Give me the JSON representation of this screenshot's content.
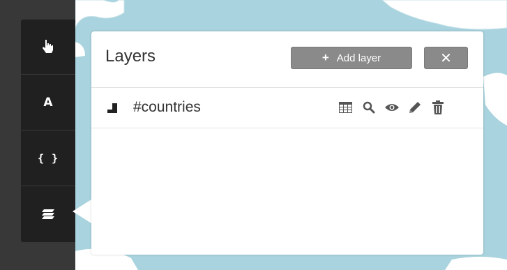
{
  "toolbar": {
    "tools": [
      {
        "name": "pointer-tool",
        "icon": "hand-pointer-icon",
        "label": ""
      },
      {
        "name": "text-tool",
        "icon": "text-icon",
        "label": "A"
      },
      {
        "name": "code-tool",
        "icon": "braces-icon",
        "label": "{ }"
      },
      {
        "name": "layers-tool",
        "icon": "layers-icon",
        "label": ""
      }
    ]
  },
  "panel": {
    "title": "Layers",
    "add_layer_label": "Add layer",
    "add_icon": "plus-icon",
    "close_icon": "close-icon",
    "close_label": "✕",
    "layers": [
      {
        "name": "#countries",
        "geometry_icon": "polygon-layer-icon",
        "actions": [
          "table-icon",
          "search-icon",
          "eye-icon",
          "pencil-icon",
          "trash-icon"
        ]
      }
    ]
  },
  "colors": {
    "rail": "#383838",
    "toolbar": "#202020",
    "water": "#a9d3de",
    "land": "#ffffff",
    "button": "#8a8a8a"
  }
}
